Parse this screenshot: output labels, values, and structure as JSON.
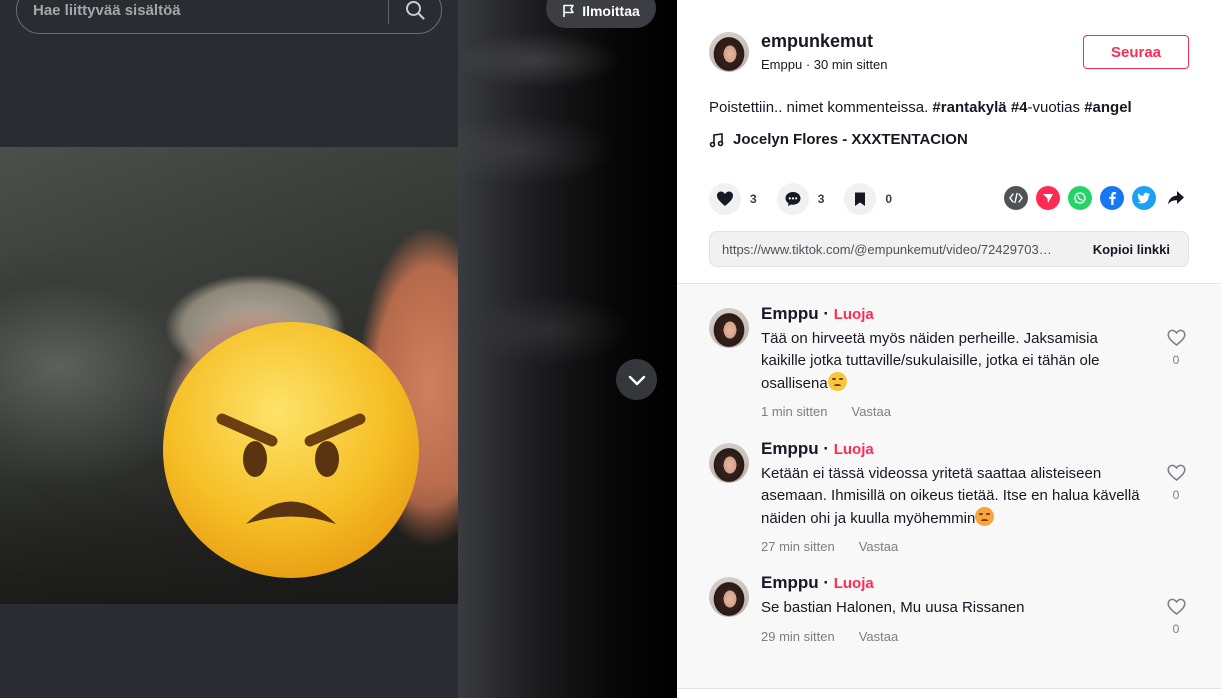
{
  "search": {
    "placeholder": "Hae liittyvää sisältöä"
  },
  "report": {
    "label": "Ilmoittaa"
  },
  "video": {
    "overlay_icon": "angry-face-emoji"
  },
  "author": {
    "username": "empunkemut",
    "display_name": "Emppu",
    "separator": " · ",
    "posted": "30 min sitten",
    "follow_label": "Seuraa"
  },
  "caption": {
    "text": "Poistettiin.. nimet kommenteissa. ",
    "tag1": "#rantakylä",
    "mid": " ",
    "tag2": "#4",
    "mid2": "-vuotias ",
    "tag3": "#angel"
  },
  "music": {
    "title": "Jocelyn Flores - XXXTENTACION"
  },
  "actions": {
    "likes": "3",
    "comments": "3",
    "saves": "0"
  },
  "share_icons": [
    "embed-icon",
    "send-icon",
    "whatsapp-icon",
    "facebook-icon",
    "twitter-icon",
    "share-arrow-icon"
  ],
  "link": {
    "url": "https://www.tiktok.com/@empunkemut/video/72429703…",
    "copy_label": "Kopioi linkki"
  },
  "comments": [
    {
      "user": "Emppu",
      "dot": " · ",
      "badge": "Luoja",
      "text": "Tää on hirveetä myös näiden perheille. Jaksamisia kaikille jotka tuttaville/sukulaisille, jotka ei tähän ole osallisena",
      "emoji": "disappointed-face-emoji",
      "time": "1 min sitten",
      "reply": "Vastaa",
      "likes": "0"
    },
    {
      "user": "Emppu",
      "dot": " · ",
      "badge": "Luoja",
      "text": "Ketään ei tässä videossa yritetä saattaa alisteiseen asemaan. Ihmisillä on oikeus tietää. Itse en halua kävellä näiden ohi ja kuulla myöhemmin",
      "emoji": "steam-face-emoji",
      "time": "27 min sitten",
      "reply": "Vastaa",
      "likes": "0"
    },
    {
      "user": "Emppu",
      "dot": " · ",
      "badge": "Luoja",
      "text": "Se bastian Halonen, Mu uusa Rissanen",
      "time": "29 min sitten",
      "reply": "Vastaa",
      "likes": "0"
    }
  ],
  "colors": {
    "accent": "#fe2c55",
    "dark": "#161823",
    "muted": "#7d7e84"
  }
}
